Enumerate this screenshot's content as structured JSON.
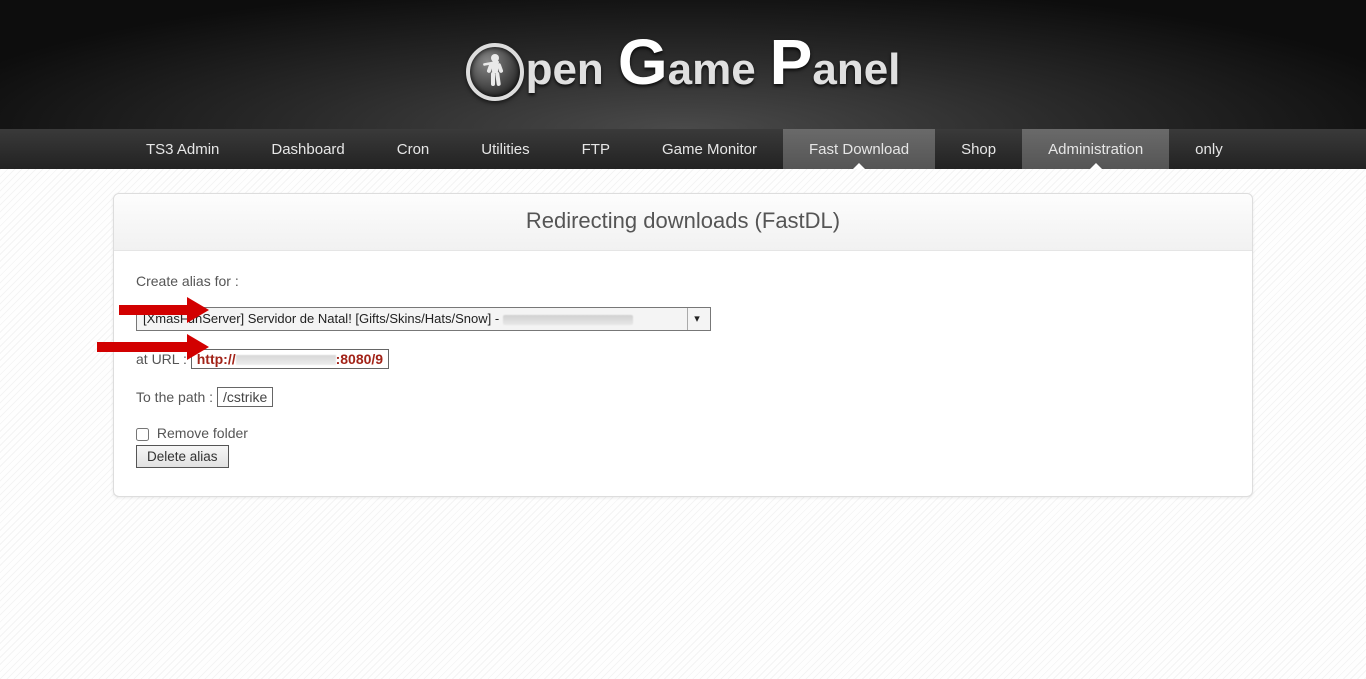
{
  "logo": {
    "word1_rest": "pen",
    "word2_cap": "G",
    "word2_rest": "ame",
    "word3_cap": "P",
    "word3_rest": "anel"
  },
  "nav": {
    "items": [
      {
        "label": "TS3 Admin",
        "active": false
      },
      {
        "label": "Dashboard",
        "active": false
      },
      {
        "label": "Cron",
        "active": false
      },
      {
        "label": "Utilities",
        "active": false
      },
      {
        "label": "FTP",
        "active": false
      },
      {
        "label": "Game Monitor",
        "active": false
      },
      {
        "label": "Fast Download",
        "active": true
      },
      {
        "label": "Shop",
        "active": false
      },
      {
        "label": "Administration",
        "active": true
      },
      {
        "label": "only",
        "active": false
      }
    ]
  },
  "panel": {
    "title": "Redirecting downloads (FastDL)",
    "create_label": "Create alias for :",
    "server_selected": "[XmasFunServer] Servidor de Natal! [Gifts/Skins/Hats/Snow] - ",
    "at_url_label": "at URL : ",
    "url_prefix": "http://",
    "url_suffix": ":8080/9",
    "path_label": "To the path : ",
    "path_value": "/cstrike",
    "remove_folder_label": "Remove folder",
    "delete_button": "Delete alias"
  }
}
